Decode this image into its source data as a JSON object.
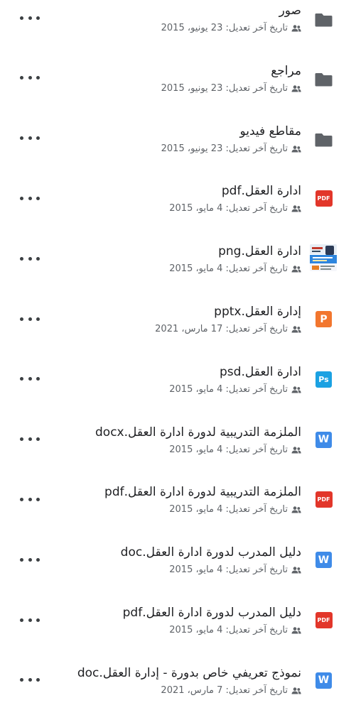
{
  "files": [
    {
      "name": "صور",
      "meta": "تاريخ آخر تعديل: 23 يونيو، 2015",
      "type": "folder",
      "icon": "folder-icon"
    },
    {
      "name": "مراجع",
      "meta": "تاريخ آخر تعديل: 23 يونيو، 2015",
      "type": "folder",
      "icon": "folder-icon"
    },
    {
      "name": "مقاطع فيديو",
      "meta": "تاريخ آخر تعديل: 23 يونيو، 2015",
      "type": "folder",
      "icon": "folder-icon"
    },
    {
      "name": "ادارة العقل.pdf",
      "meta": "تاريخ آخر تعديل: 4 مايو، 2015",
      "type": "pdf",
      "icon": "pdf-icon",
      "badge": "PDF"
    },
    {
      "name": "ادارة العقل.png",
      "meta": "تاريخ آخر تعديل: 4 مايو، 2015",
      "type": "image",
      "icon": "image-thumbnail"
    },
    {
      "name": "إدارة العقل.pptx",
      "meta": "تاريخ آخر تعديل: 17 مارس، 2021",
      "type": "pptx",
      "icon": "powerpoint-icon",
      "badge": "P"
    },
    {
      "name": "ادارة العقل.psd",
      "meta": "تاريخ آخر تعديل: 4 مايو، 2015",
      "type": "psd",
      "icon": "photoshop-icon",
      "badge": "Ps"
    },
    {
      "name": "الملزمة التدريبية لدورة ادارة العقل.docx",
      "meta": "تاريخ آخر تعديل: 4 مايو، 2015",
      "type": "docx",
      "icon": "word-icon",
      "badge": "W"
    },
    {
      "name": "الملزمة التدريبية لدورة ادارة العقل.pdf",
      "meta": "تاريخ آخر تعديل: 4 مايو، 2015",
      "type": "pdf",
      "icon": "pdf-icon",
      "badge": "PDF"
    },
    {
      "name": "دليل المدرب لدورة ادارة العقل.doc",
      "meta": "تاريخ آخر تعديل: 4 مايو، 2015",
      "type": "doc",
      "icon": "word-icon",
      "badge": "W"
    },
    {
      "name": "دليل المدرب لدورة ادارة العقل.pdf",
      "meta": "تاريخ آخر تعديل: 4 مايو، 2015",
      "type": "pdf",
      "icon": "pdf-icon",
      "badge": "PDF"
    },
    {
      "name": "نموذج تعريفي خاص بدورة - إدارة العقل.doc",
      "meta": "تاريخ آخر تعديل: 7 مارس، 2021",
      "type": "doc",
      "icon": "word-icon",
      "badge": "W"
    }
  ],
  "colors": {
    "folder": "#5f6368",
    "pdf": "#e2362a",
    "powerpoint": "#f2762e",
    "photoshop": "#1ba1e2",
    "word": "#3f8be8",
    "text_primary": "#202124",
    "text_secondary": "#5f6368"
  },
  "shared_icon": "shared-people-icon",
  "more_icon": "more-options-icon"
}
